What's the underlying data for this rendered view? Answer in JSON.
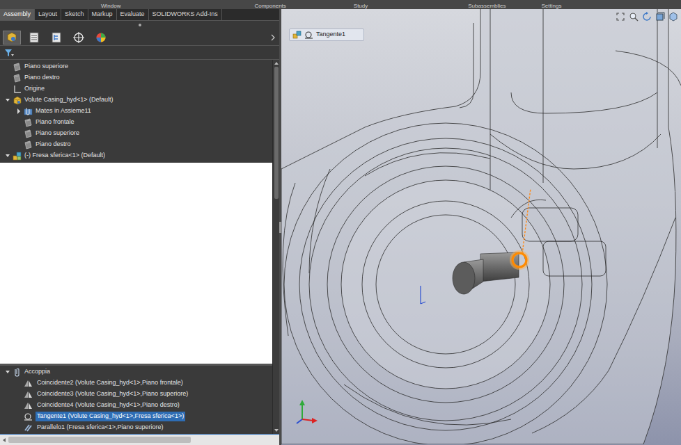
{
  "top_menu": [
    "Window",
    "Components",
    "Study",
    "Subassemblies",
    "Settings"
  ],
  "tabs": [
    {
      "label": "Assembly",
      "selected": true
    },
    {
      "label": "Layout",
      "selected": false
    },
    {
      "label": "Sketch",
      "selected": false
    },
    {
      "label": "Markup",
      "selected": false
    },
    {
      "label": "Evaluate",
      "selected": false
    },
    {
      "label": "SOLIDWORKS Add-Ins",
      "selected": false
    }
  ],
  "panel_tabs": [
    {
      "kind": "feature",
      "selected": true
    },
    {
      "kind": "property",
      "selected": false
    },
    {
      "kind": "config",
      "selected": false
    },
    {
      "kind": "dimxpert",
      "selected": false
    },
    {
      "kind": "display",
      "selected": false
    }
  ],
  "tree": [
    {
      "label": "Piano superiore",
      "kind": "plane",
      "depth": 0,
      "expandable": false,
      "expanded": false
    },
    {
      "label": "Piano destro",
      "kind": "plane",
      "depth": 0,
      "expandable": false,
      "expanded": false
    },
    {
      "label": "Origine",
      "kind": "origin",
      "depth": 0,
      "expandable": false,
      "expanded": false
    },
    {
      "label": "Volute Casing_hyd<1> (Default)",
      "kind": "part",
      "depth": 0,
      "expandable": true,
      "expanded": true
    },
    {
      "label": "Mates in Assieme11",
      "kind": "mates-folder",
      "depth": 1,
      "expandable": true,
      "expanded": false
    },
    {
      "label": "Piano frontale",
      "kind": "plane",
      "depth": 1,
      "expandable": false,
      "expanded": false
    },
    {
      "label": "Piano superiore",
      "kind": "plane",
      "depth": 1,
      "expandable": false,
      "expanded": false
    },
    {
      "label": "Piano destro",
      "kind": "plane",
      "depth": 1,
      "expandable": false,
      "expanded": false
    },
    {
      "label": "(-) Fresa sferica<1> (Default)",
      "kind": "assembly",
      "depth": 0,
      "expandable": true,
      "expanded": true
    }
  ],
  "mates": {
    "label": "Accoppia",
    "expanded": true,
    "items": [
      {
        "label": "Coincidente2 (Volute Casing_hyd<1>,Piano frontale)",
        "kind": "coincident",
        "selected": false
      },
      {
        "label": "Coincidente3 (Volute Casing_hyd<1>,Piano superiore)",
        "kind": "coincident",
        "selected": false
      },
      {
        "label": "Coincidente4 (Volute Casing_hyd<1>,Piano destro)",
        "kind": "coincident",
        "selected": false
      },
      {
        "label": "Tangente1 (Volute Casing_hyd<1>,Fresa sferica<1>)",
        "kind": "tangent",
        "selected": true
      },
      {
        "label": "Parallelo1 (Fresa sferica<1>,Piano superiore)",
        "kind": "parallel",
        "selected": false
      }
    ]
  },
  "viewport": {
    "breadcrumb": "Tangente1"
  }
}
